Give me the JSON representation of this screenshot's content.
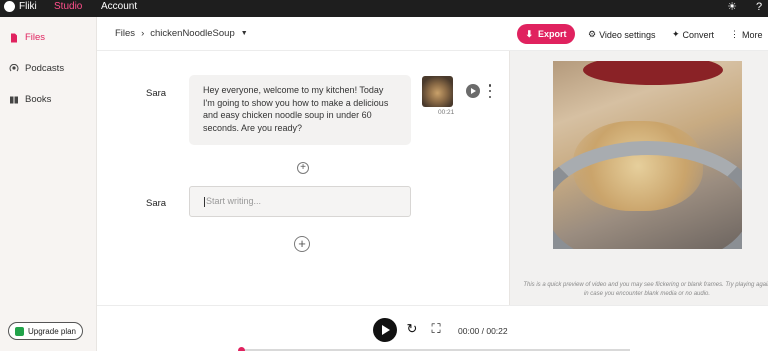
{
  "topbar": {
    "brand": "Fliki",
    "nav": [
      {
        "label": "Studio",
        "active": true
      },
      {
        "label": "Account",
        "active": false
      }
    ]
  },
  "sidebar": {
    "items": [
      {
        "label": "Files",
        "icon": "file-icon",
        "active": true
      },
      {
        "label": "Podcasts",
        "icon": "podcast-icon",
        "active": false
      },
      {
        "label": "Books",
        "icon": "book-icon",
        "active": false
      }
    ],
    "upgrade_label": "Upgrade plan"
  },
  "header": {
    "breadcrumb_root": "Files",
    "breadcrumb_separator": "›",
    "project_name": "chickenNoodleSoup",
    "export_label": "Export",
    "video_settings_label": "Video settings",
    "convert_label": "Convert",
    "more_label": "More"
  },
  "editor": {
    "blocks": [
      {
        "speaker": "Sara",
        "text": "Hey everyone, welcome to my kitchen! Today I'm going to show you how to make a delicious and easy chicken noodle soup in under 60 seconds. Are you ready?",
        "media_duration": "00:21"
      },
      {
        "speaker": "Sara",
        "placeholder": "Start writing..."
      }
    ]
  },
  "preview": {
    "note": "This is a quick preview of video and you may see flickering or blank frames. Try playing again in case you encounter blank media or no audio."
  },
  "player": {
    "time_display": "00:00 / 00:22",
    "progress": 0
  },
  "colors": {
    "accent": "#e0225f",
    "topbar": "#1e1e1e",
    "sidebar": "#f7f4f2"
  }
}
